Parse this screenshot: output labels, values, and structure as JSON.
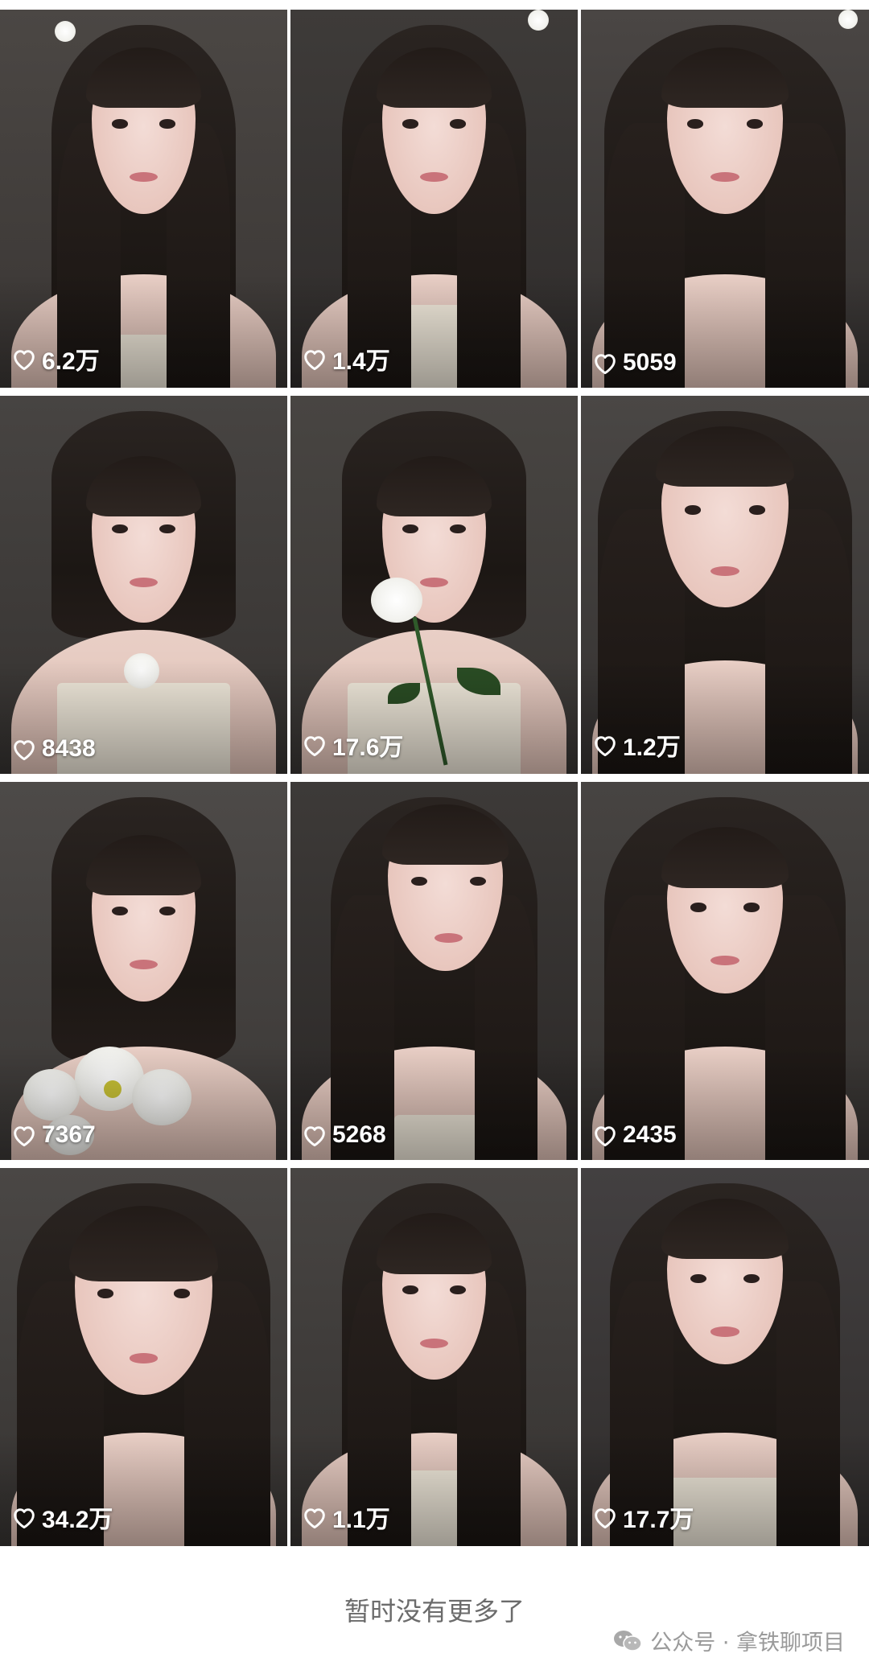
{
  "grid": {
    "items": [
      {
        "likes": "6.2万"
      },
      {
        "likes": "1.4万"
      },
      {
        "likes": "5059"
      },
      {
        "likes": "8438"
      },
      {
        "likes": "17.6万"
      },
      {
        "likes": "1.2万"
      },
      {
        "likes": "7367"
      },
      {
        "likes": "5268"
      },
      {
        "likes": "2435"
      },
      {
        "likes": "34.2万"
      },
      {
        "likes": "1.1万"
      },
      {
        "likes": "17.7万"
      }
    ]
  },
  "icons": {
    "like": "heart-outline-icon",
    "watermark": "wechat-icon"
  },
  "footer": {
    "no_more_text": "暂时没有更多了",
    "watermark_text": "公众号 · 拿铁聊项目"
  },
  "colors": {
    "page_background": "#ffffff",
    "like_text": "#ffffff",
    "footer_text": "#6b6b6b",
    "watermark_text": "#9a9a9a"
  }
}
